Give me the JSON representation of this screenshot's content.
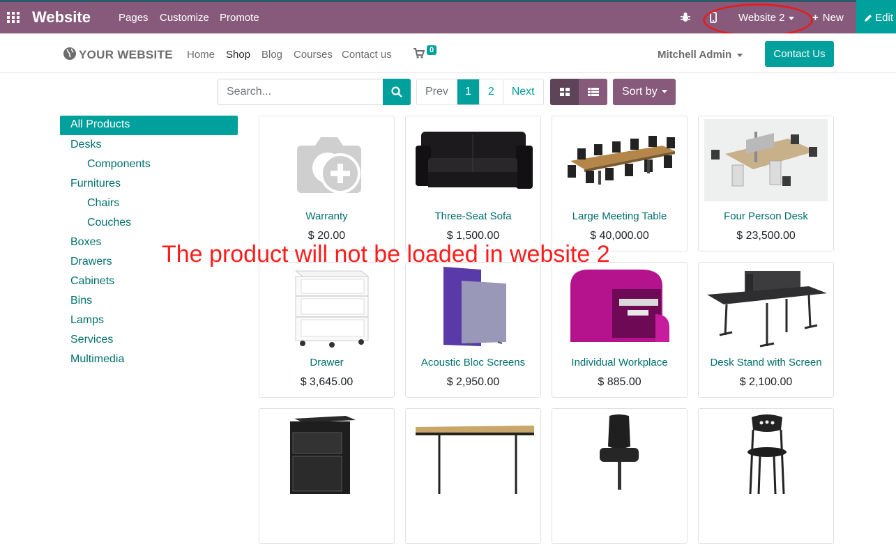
{
  "admin_bar": {
    "brand": "Website",
    "menu": [
      "Pages",
      "Customize",
      "Promote"
    ],
    "website_switcher": "Website 2",
    "new_label": "New",
    "edit_label": "Edit"
  },
  "site_nav": {
    "logo_text": "YOUR WEBSITE",
    "links": [
      "Home",
      "Shop",
      "Blog",
      "Courses",
      "Contact us"
    ],
    "active_link": "Shop",
    "cart_count": "0",
    "user_name": "Mitchell Admin",
    "contact_button": "Contact Us"
  },
  "toolbar": {
    "search_placeholder": "Search...",
    "pager": {
      "prev": "Prev",
      "pages": [
        "1",
        "2"
      ],
      "current": "1",
      "next": "Next"
    },
    "sort_label": "Sort by"
  },
  "categories": [
    {
      "label": "All Products",
      "level": 0,
      "active": true
    },
    {
      "label": "Desks",
      "level": 0
    },
    {
      "label": "Components",
      "level": 1
    },
    {
      "label": "Furnitures",
      "level": 0
    },
    {
      "label": "Chairs",
      "level": 1
    },
    {
      "label": "Couches",
      "level": 1
    },
    {
      "label": "Boxes",
      "level": 0
    },
    {
      "label": "Drawers",
      "level": 0
    },
    {
      "label": "Cabinets",
      "level": 0
    },
    {
      "label": "Bins",
      "level": 0
    },
    {
      "label": "Lamps",
      "level": 0
    },
    {
      "label": "Services",
      "level": 0
    },
    {
      "label": "Multimedia",
      "level": 0
    }
  ],
  "products": [
    {
      "name": "Warranty",
      "price": "$ 20.00"
    },
    {
      "name": "Three-Seat Sofa",
      "price": "$ 1,500.00"
    },
    {
      "name": "Large Meeting Table",
      "price": "$ 40,000.00"
    },
    {
      "name": "Four Person Desk",
      "price": "$ 23,500.00"
    },
    {
      "name": "Drawer",
      "price": "$ 3,645.00"
    },
    {
      "name": "Acoustic Bloc Screens",
      "price": "$ 2,950.00"
    },
    {
      "name": "Individual Workplace",
      "price": "$ 885.00"
    },
    {
      "name": "Desk Stand with Screen",
      "price": "$ 2,100.00"
    }
  ],
  "annotation": "The product will not be loaded in website 2",
  "colors": {
    "primary": "#875A7B",
    "accent": "#00A09D",
    "annotation": "#ff1c1c"
  }
}
